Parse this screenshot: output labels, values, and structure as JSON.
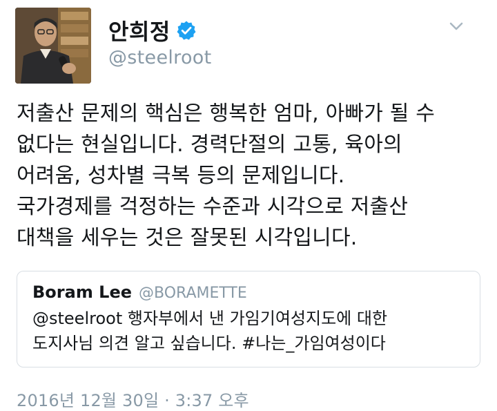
{
  "author": {
    "display_name": "안희정",
    "handle": "@steelroot",
    "verified": true,
    "avatar_icon": "profile-photo"
  },
  "menu": {
    "icon": "chevron-down-icon"
  },
  "tweet": {
    "lines": [
      "저출산 문제의 핵심은 행복한 엄마, 아빠가 될 수",
      "없다는 현실입니다. 경력단절의 고통, 육아의",
      "어려움, 성차별 극복 등의 문제입니다.",
      "국가경제를 걱정하는 수준과 시각으로 저출산",
      "대책을 세우는 것은 잘못된 시각입니다."
    ]
  },
  "quoted_tweet": {
    "display_name": "Boram Lee",
    "handle": "@BORAMETTE",
    "lines": [
      "@steelroot 행자부에서 낸 가임기여성지도에 대한",
      "도지사님 의견 알고 싶습니다. #나는_가임여성이다"
    ]
  },
  "timestamp": "2016년 12월 30일 · 3:37 오후",
  "colors": {
    "text": "#14171a",
    "secondary": "#8899a6",
    "verified_blue": "#1da1f2",
    "border": "#d8dee3"
  }
}
